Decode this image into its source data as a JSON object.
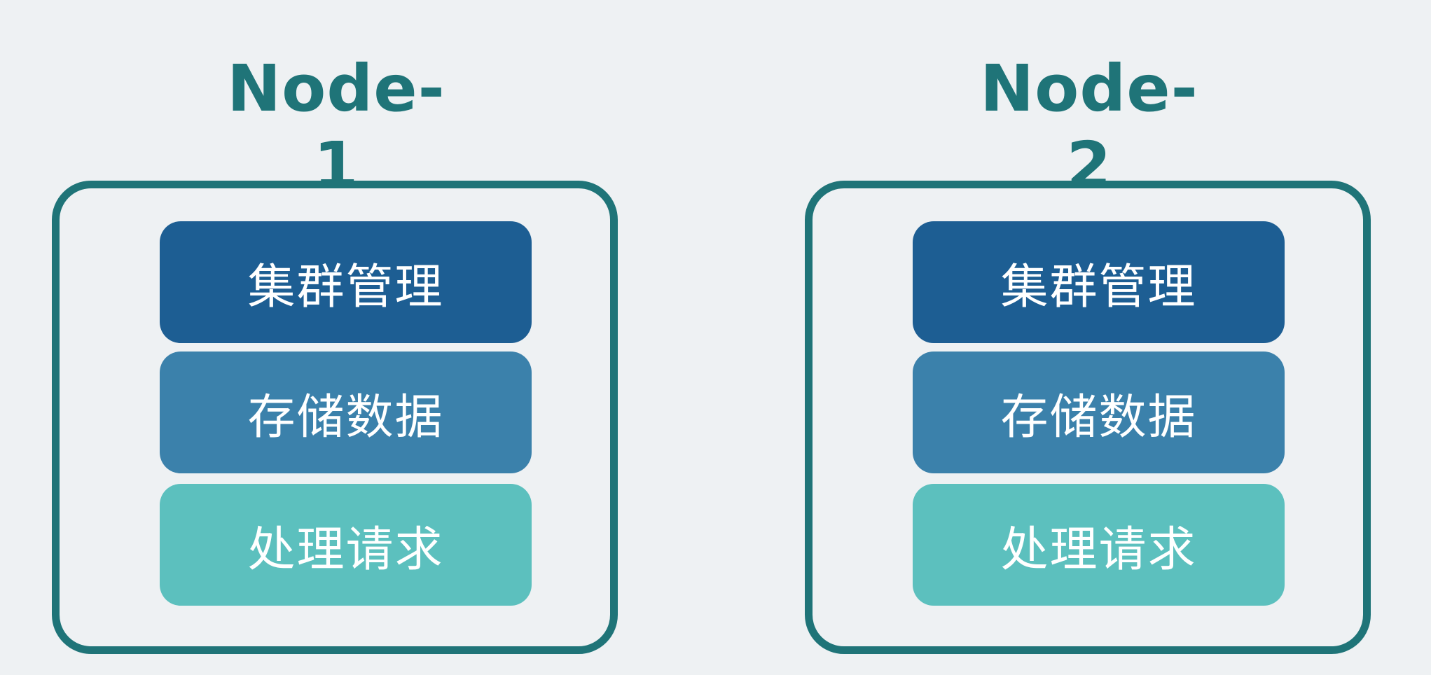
{
  "nodes": [
    {
      "title": "Node-1",
      "layers": [
        {
          "label": "集群管理",
          "color": "#1d5e93"
        },
        {
          "label": "存储数据",
          "color": "#3b81ab"
        },
        {
          "label": "处理请求",
          "color": "#5cc0be"
        }
      ]
    },
    {
      "title": "Node-2",
      "layers": [
        {
          "label": "集群管理",
          "color": "#1d5e93"
        },
        {
          "label": "存储数据",
          "color": "#3b81ab"
        },
        {
          "label": "处理请求",
          "color": "#5cc0be"
        }
      ]
    }
  ],
  "colors": {
    "background": "#eef1f3",
    "frame": "#1f7478",
    "title": "#1f7478"
  }
}
